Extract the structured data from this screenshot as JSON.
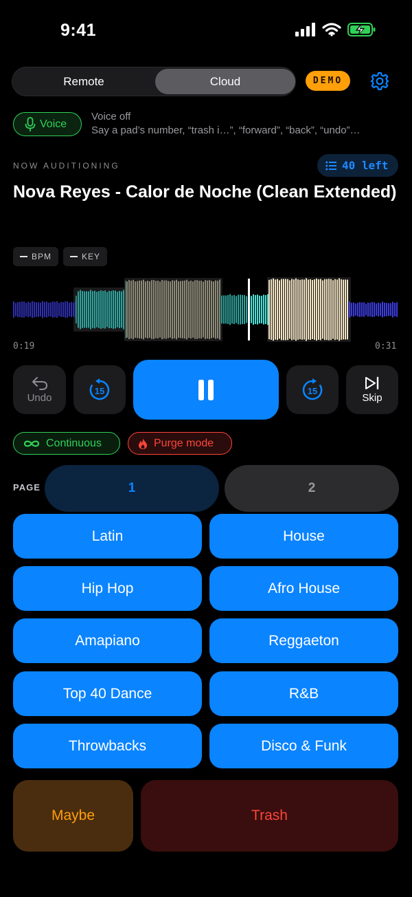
{
  "status_bar": {
    "time": "9:41"
  },
  "top_bar": {
    "segments": [
      "Remote",
      "Cloud"
    ],
    "selected_segment": "Cloud",
    "demo_badge": "DEMO",
    "icon_settings": "gear-icon"
  },
  "voice": {
    "button_label": "Voice",
    "status": "Voice off",
    "help": "Say a pad’s number, “trash i…”, “forward”, “back”, “undo”…"
  },
  "now": {
    "label": "NOW AUDITIONING",
    "remaining": "40 left",
    "title": "Nova Reyes - Calor de Noche (Clean Extended)",
    "bpm_label": "BPM",
    "key_label": "KEY",
    "elapsed": "0:19",
    "total": "0:31"
  },
  "transport": {
    "undo_label": "Undo",
    "rewind_seconds": "15",
    "forward_seconds": "15",
    "skip_label": "Skip",
    "state": "playing"
  },
  "modes": {
    "continuous": "Continuous",
    "purge": "Purge mode"
  },
  "pages": {
    "label": "PAGE",
    "items": [
      "1",
      "2"
    ],
    "selected": "1"
  },
  "pads": [
    "Latin",
    "House",
    "Hip Hop",
    "Afro House",
    "Amapiano",
    "Reggaeton",
    "Top 40 Dance",
    "R&B",
    "Throwbacks",
    "Disco & Funk"
  ],
  "actions": {
    "maybe": "Maybe",
    "trash": "Trash"
  },
  "colors": {
    "accent_blue": "#0a84ff",
    "green": "#30d158",
    "red": "#ff453a",
    "orange": "#ff9f0a",
    "waveform_played": "#2f2fb0",
    "waveform_cyan": "#3fc9c4"
  }
}
